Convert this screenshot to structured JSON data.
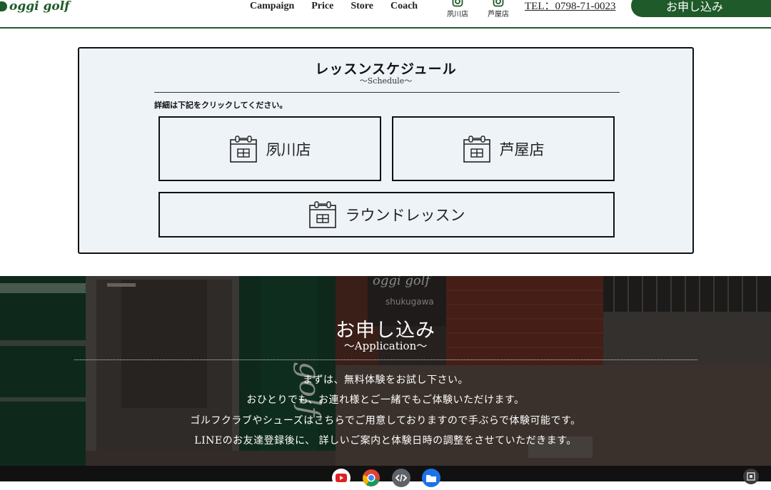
{
  "header": {
    "logo": "oggi golf",
    "nav": [
      "Campaign",
      "Price",
      "Store",
      "Coach"
    ],
    "stores": [
      "夙川店",
      "芦屋店"
    ],
    "tel": "TEL：0798-71-0023",
    "apply": "お申し込み",
    "accent": "#1f5a2a"
  },
  "schedule": {
    "title": "レッスンスケジュール",
    "subtitle": "〜Schedule〜",
    "note": "詳細は下記をクリックしてください。",
    "buttons": [
      "夙川店",
      "芦屋店",
      "ラウンドレッスン"
    ],
    "icon": "calendar-icon"
  },
  "application": {
    "bg_sign_text": "oggi golf",
    "bg_sign_sub": "shukugawa",
    "title": "お申し込み",
    "subtitle": "〜Application〜",
    "lines": [
      "まずは、無料体験をお試し下さい。",
      "おひとりでも、お連れ様とご一緒でもご体験いただけます。",
      "ゴルフクラブやシューズはこちらでご用意しておりますので手ぶらで体験可能です。",
      "LINEのお友達登録後に、 詳しいご案内と体験日時の調整をさせていただきます。"
    ]
  },
  "taskbar": {
    "icons": [
      "youtube-icon",
      "chrome-icon",
      "code-icon",
      "files-icon",
      "screen-capture-icon"
    ]
  }
}
